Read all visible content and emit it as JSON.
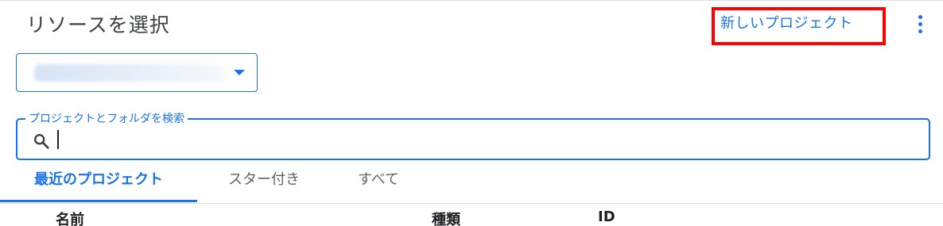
{
  "dialog": {
    "title": "リソースを選択",
    "new_project_label": "新しいプロジェクト",
    "more_icon": "more-vert-icon"
  },
  "org_selector": {
    "value": "",
    "caret_icon": "arrow-drop-down-icon"
  },
  "search": {
    "label": "プロジェクトとフォルダを検索",
    "value": "",
    "icon": "search-icon"
  },
  "tabs": [
    {
      "label": "最近のプロジェクト",
      "active": true
    },
    {
      "label": "スター付き",
      "active": false
    },
    {
      "label": "すべて",
      "active": false
    }
  ],
  "table": {
    "columns": [
      "名前",
      "種類",
      "ID"
    ]
  },
  "colors": {
    "accent": "#1a73e8",
    "highlight": "#ff0000"
  }
}
